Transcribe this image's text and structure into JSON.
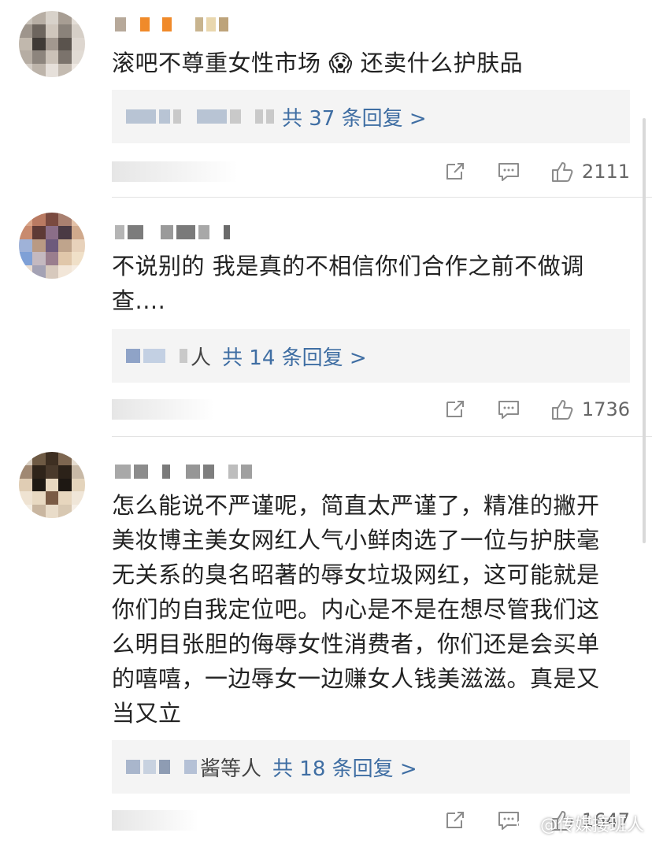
{
  "comments": [
    {
      "text": "滚吧不尊重女性市场 😱 还卖什么护肤品",
      "reply_label": "共 37 条回复 >",
      "likes": "2111"
    },
    {
      "text": "不说别的 我是真的不相信你们合作之前不做调查....",
      "reply_prefix": "人",
      "reply_label": "共 14 条回复 >",
      "likes": "1736"
    },
    {
      "text": "怎么能说不严谨呢，简直太严谨了，精准的撇开美妆博主美女网红人气小鲜肉选了一位与护肤毫无关系的臭名昭著的辱女垃圾网红，这可能就是你们的自我定位吧。内心是不是在想尽管我们这么明目张胆的侮辱女性消费者，你们还是会买单的嘻嘻，一边辱女一边赚女人钱美滋滋。真是又当又立",
      "reply_prefix": "酱等人",
      "reply_label": "共 18 条回复 >",
      "likes": "1647"
    }
  ],
  "icons": [
    "share-icon",
    "comment-icon",
    "like-icon"
  ],
  "watermark": "@传媒接班人"
}
